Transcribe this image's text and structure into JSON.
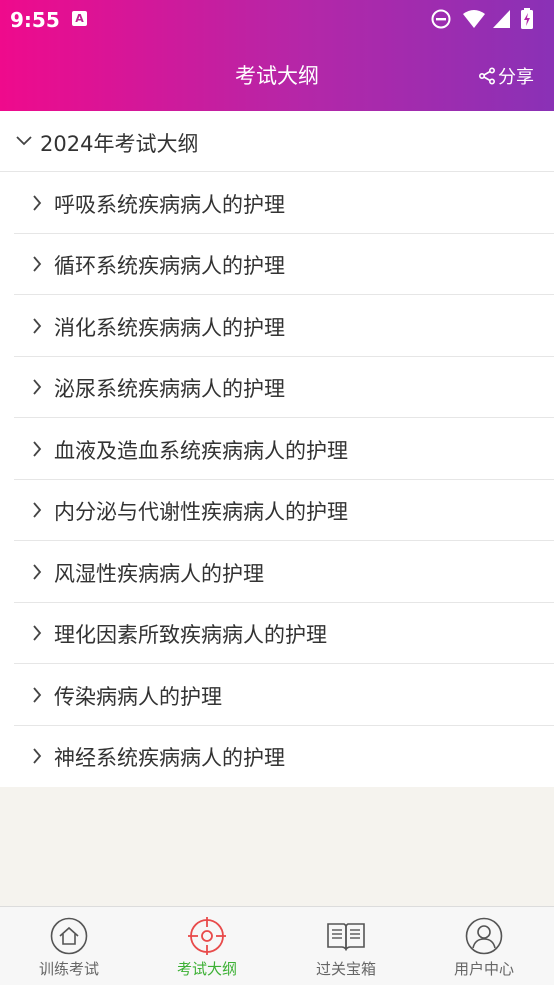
{
  "status_bar": {
    "time": "9:55",
    "notification_icon": "A"
  },
  "header": {
    "title": "考试大纲",
    "share_label": "分享"
  },
  "section": {
    "label": "2024年考试大纲",
    "expanded": true
  },
  "items": [
    {
      "label": "呼吸系统疾病病人的护理"
    },
    {
      "label": "循环系统疾病病人的护理"
    },
    {
      "label": "消化系统疾病病人的护理"
    },
    {
      "label": "泌尿系统疾病病人的护理"
    },
    {
      "label": "血液及造血系统疾病病人的护理"
    },
    {
      "label": "内分泌与代谢性疾病病人的护理"
    },
    {
      "label": "风湿性疾病病人的护理"
    },
    {
      "label": "理化因素所致疾病病人的护理"
    },
    {
      "label": "传染病病人的护理"
    },
    {
      "label": "神经系统疾病病人的护理"
    }
  ],
  "tabs": [
    {
      "label": "训练考试",
      "icon": "home-icon",
      "active": false
    },
    {
      "label": "考试大纲",
      "icon": "target-icon",
      "active": true
    },
    {
      "label": "过关宝箱",
      "icon": "book-icon",
      "active": false
    },
    {
      "label": "用户中心",
      "icon": "user-icon",
      "active": false
    }
  ],
  "colors": {
    "header_start": "#ef0a8c",
    "header_end": "#8a31b6",
    "active_tab": "#3cb034",
    "target_icon": "#e84a4a"
  }
}
